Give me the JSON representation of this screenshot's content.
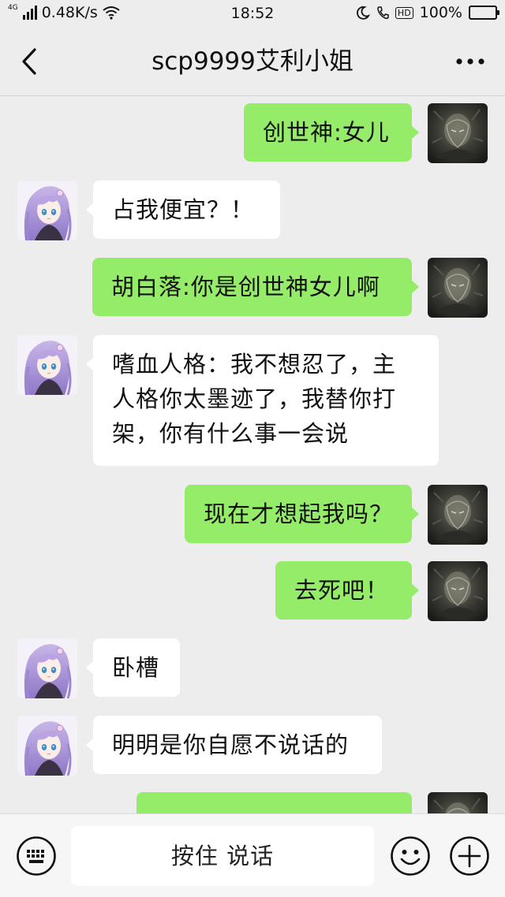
{
  "status_bar": {
    "network_type": "4G",
    "speed": "0.48K/s",
    "time": "18:52",
    "hd_label": "HD",
    "battery": "100%"
  },
  "header": {
    "title": "scp9999艾利小姐"
  },
  "messages": [
    {
      "direction": "out",
      "text": "创世神:女儿"
    },
    {
      "direction": "in",
      "text": "占我便宜？！"
    },
    {
      "direction": "out",
      "text": "胡白落:你是创世神女儿啊"
    },
    {
      "direction": "in",
      "lines": [
        "嗜血人格：我不想忍了，主",
        "人格你太墨迹了，我替你打",
        "架，你有什么事一会说"
      ]
    },
    {
      "direction": "out",
      "text": "现在才想起我吗？"
    },
    {
      "direction": "out",
      "text": "去死吧！"
    },
    {
      "direction": "in",
      "text": "卧槽"
    },
    {
      "direction": "in",
      "text": "明明是你自愿不说话的"
    },
    {
      "direction": "out",
      "text": ""
    }
  ],
  "input_bar": {
    "voice_button_label": "按住 说话",
    "icons": [
      "keyboard-icon",
      "emoji-icon",
      "plus-icon"
    ]
  },
  "colors": {
    "outgoing_bubble": "#95ec69",
    "incoming_bubble": "#ffffff",
    "background": "#ededed"
  }
}
